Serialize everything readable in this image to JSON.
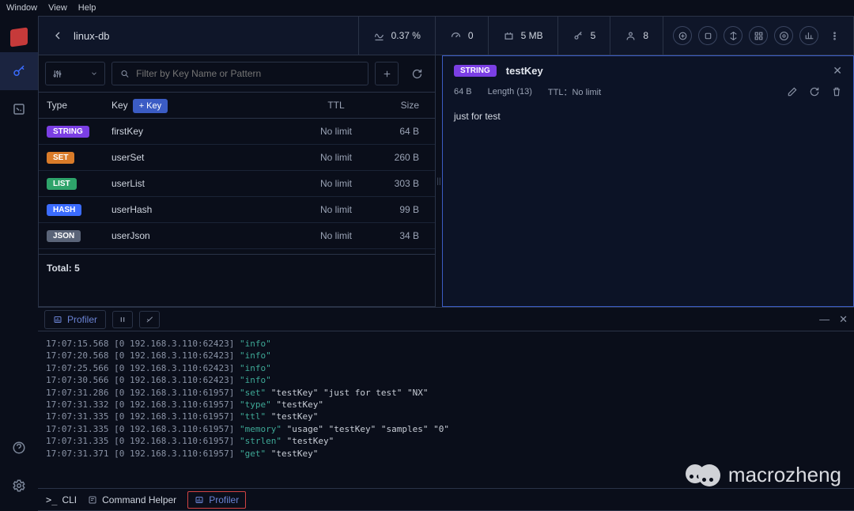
{
  "menu": {
    "window": "Window",
    "view": "View",
    "help": "Help"
  },
  "header": {
    "db_name": "linux-db",
    "stats": {
      "cpu": "0.37 %",
      "ops": "0",
      "memory": "5 MB",
      "keys": "5",
      "clients": "8"
    }
  },
  "filter": {
    "placeholder": "Filter by Key Name or Pattern"
  },
  "table": {
    "headers": {
      "type": "Type",
      "key": "Key",
      "add": "+ Key",
      "ttl": "TTL",
      "size": "Size"
    },
    "rows": [
      {
        "badge": "STRING",
        "color": "#7b3fe4",
        "key": "firstKey",
        "ttl": "No limit",
        "size": "64 B"
      },
      {
        "badge": "SET",
        "color": "#d97b29",
        "key": "userSet",
        "ttl": "No limit",
        "size": "260 B"
      },
      {
        "badge": "LIST",
        "color": "#2ea36a",
        "key": "userList",
        "ttl": "No limit",
        "size": "303 B"
      },
      {
        "badge": "HASH",
        "color": "#3b6cff",
        "key": "userHash",
        "ttl": "No limit",
        "size": "99 B"
      },
      {
        "badge": "JSON",
        "color": "#5a6478",
        "key": "userJson",
        "ttl": "No limit",
        "size": "34 B"
      }
    ],
    "footer": "Total: 5"
  },
  "detail": {
    "badge": "STRING",
    "badge_color": "#7b3fe4",
    "key": "testKey",
    "size": "64 B",
    "length_label": "Length (13)",
    "ttl_label": "TTL：No limit",
    "value": "just for test"
  },
  "profiler": {
    "tab": "Profiler",
    "logs": [
      {
        "meta": "17:07:15.568 [0 192.168.3.110:62423]",
        "cmd": "\"info\"",
        "rest": ""
      },
      {
        "meta": "17:07:20.568 [0 192.168.3.110:62423]",
        "cmd": "\"info\"",
        "rest": ""
      },
      {
        "meta": "17:07:25.566 [0 192.168.3.110:62423]",
        "cmd": "\"info\"",
        "rest": ""
      },
      {
        "meta": "17:07:30.566 [0 192.168.3.110:62423]",
        "cmd": "\"info\"",
        "rest": ""
      },
      {
        "meta": "17:07:31.286 [0 192.168.3.110:61957]",
        "cmd": "\"set\"",
        "rest": " \"testKey\" \"just for test\" \"NX\""
      },
      {
        "meta": "17:07:31.332 [0 192.168.3.110:61957]",
        "cmd": "\"type\"",
        "rest": " \"testKey\""
      },
      {
        "meta": "17:07:31.335 [0 192.168.3.110:61957]",
        "cmd": "\"ttl\"",
        "rest": " \"testKey\""
      },
      {
        "meta": "17:07:31.335 [0 192.168.3.110:61957]",
        "cmd": "\"memory\"",
        "rest": " \"usage\" \"testKey\" \"samples\" \"0\""
      },
      {
        "meta": "17:07:31.335 [0 192.168.3.110:61957]",
        "cmd": "\"strlen\"",
        "rest": " \"testKey\""
      },
      {
        "meta": "17:07:31.371 [0 192.168.3.110:61957]",
        "cmd": "\"get\"",
        "rest": " \"testKey\""
      }
    ],
    "footer": {
      "cli": "CLI",
      "helper": "Command Helper",
      "profiler": "Profiler"
    }
  },
  "watermark": "macrozheng"
}
